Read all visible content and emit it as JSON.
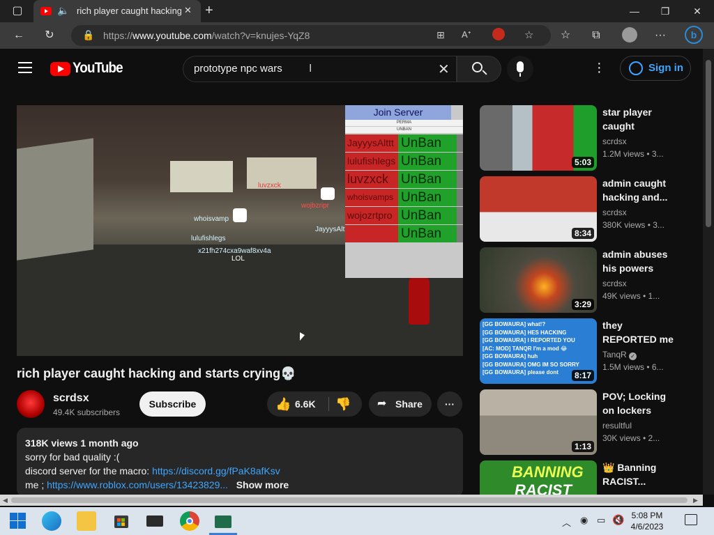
{
  "browser": {
    "tab_title": "rich player caught hacking a",
    "url_prefix": "https://",
    "url_domain": "www.youtube.com",
    "url_path": "/watch?v=knujes-YqZ8"
  },
  "youtube": {
    "logo_text": "YouTube",
    "search_value": "prototype npc wars",
    "signin_label": "Sign in"
  },
  "player_scene": {
    "board_title": "Join Server",
    "board_row1": "PERMA",
    "board_row2": "UNBAN",
    "rows": [
      {
        "name": "JayyysAlttt",
        "action": "UnBan"
      },
      {
        "name": "lulufishlegs",
        "action": "UnBan"
      },
      {
        "name": "luvzxck",
        "action": "UnBan"
      },
      {
        "name": "whoisvamps",
        "action": "UnBan"
      },
      {
        "name": "wojozrtpro",
        "action": "UnBan"
      },
      {
        "name": "",
        "action": "UnBan"
      }
    ],
    "tags": {
      "luvzxck": "luvzxck",
      "whoisvamp": "whoisvamp",
      "wojbzripr": "wojbzripr",
      "jayyys": "JayyysAlttt",
      "lulufishlegs": "lulufishlegs",
      "x21": "x21fh274cxa9waf8xv4a",
      "lol": "LOL"
    }
  },
  "video": {
    "title": "rich player caught hacking and starts crying💀",
    "channel": "scrdsx",
    "subscribers": "49.4K subscribers",
    "subscribe_label": "Subscribe",
    "likes": "6.6K",
    "share_label": "Share",
    "views_date": "318K views  1 month ago",
    "desc_line1": "sorry for bad quality :(",
    "desc_line2_prefix": "discord server for the macro: ",
    "desc_line2_link": "https://discord.gg/fPaK8afKsv",
    "desc_line3_prefix": "me ; ",
    "desc_line3_link": "https://www.roblox.com/users/13423829...",
    "show_more": "Show more"
  },
  "recommendations": [
    {
      "title": "star player caught hackin...",
      "channel": "scrdsx",
      "meta": "1.2M views  • 3...",
      "duration": "5:03"
    },
    {
      "title": "admin caught hacking and...",
      "channel": "scrdsx",
      "meta": "380K views  • 3...",
      "duration": "8:34"
    },
    {
      "title": "admin abuses his powers on...",
      "channel": "scrdsx",
      "meta": "49K views  • 1...",
      "duration": "3:29"
    },
    {
      "title": "they REPORTED me for...",
      "channel": "TanqR",
      "meta": "1.5M views  • 6...",
      "duration": "8:17"
    },
    {
      "title": "POV; Locking on lockers",
      "channel": "resultful",
      "meta": "30K views  • 2...",
      "duration": "1:13"
    },
    {
      "title": "👑 Banning RACIST...",
      "channel": "",
      "meta": "",
      "duration": ""
    }
  ],
  "thumb_text": {
    "rec4_lines": [
      "[GG BOWAURA] what!?",
      "[GG BOWAURA] HES HACKING",
      "[GG BOWAURA] I REPORTED YOU",
      "[AC: MOD] TANQR I'm a mod 😂",
      "[GG BOWAURA] huh",
      "[GG BOWAURA] OMG IM SO SORRY",
      "[GG BOWAURA] please dont"
    ],
    "rec6_big": "BANNING",
    "rec6_big2": "RACIST"
  },
  "taskbar": {
    "time": "5:08 PM",
    "date": "4/6/2023"
  },
  "colors": {
    "accent_link": "#3ea6ff",
    "yt_red": "#ff0000"
  }
}
